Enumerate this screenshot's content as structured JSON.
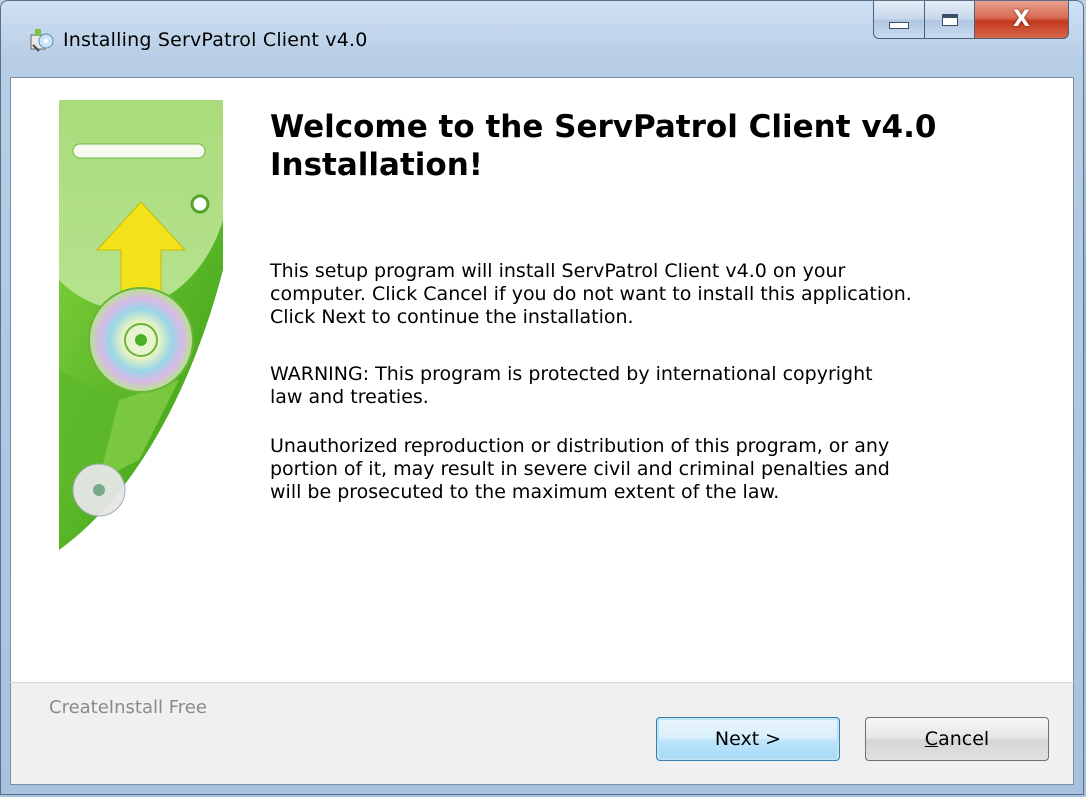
{
  "window": {
    "title": "Installing ServPatrol Client v4.0",
    "close_glyph": "X",
    "icons": [
      "installer-app-icon",
      "minimize-icon",
      "maximize-icon",
      "close-icon"
    ]
  },
  "content": {
    "heading": "Welcome to the ServPatrol Client v4.0 Installation!",
    "paragraph_1": "This setup program will install ServPatrol Client v4.0 on your\ncomputer. Click Cancel if you do not want to install this application.\nClick Next to continue the installation.",
    "paragraph_2": "WARNING: This program is protected by international copyright\nlaw and treaties.",
    "paragraph_3": "Unauthorized reproduction or distribution of this program, or any\nportion of it, may result in severe civil and criminal penalties and\nwill be prosecuted to the maximum extent of the law."
  },
  "footer": {
    "brand": "CreateInstall Free",
    "next_label": "Next >",
    "cancel_label_accel": "C",
    "cancel_label_rest": "ancel"
  },
  "colors": {
    "banner_green": "#4caf28",
    "banner_light": "#c9e9a8",
    "arrow_yellow": "#f2e21a",
    "next_border": "#3c7fb1"
  }
}
